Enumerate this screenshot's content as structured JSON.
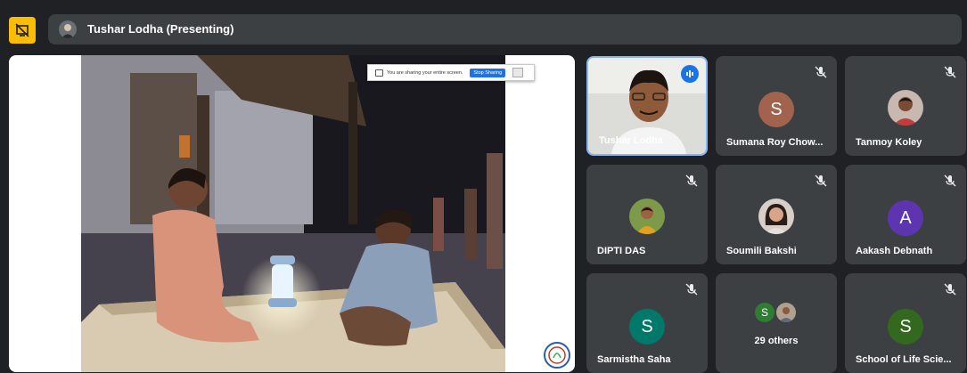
{
  "presenter": {
    "name": "Tushar Lodha (Presenting)"
  },
  "share_bar": {
    "message": "You are sharing your entire screen.",
    "stop_label": "Stop Sharing"
  },
  "participants": [
    {
      "name": "Tushar Lodha",
      "type": "video",
      "speaking": true
    },
    {
      "name": "Sumana Roy Chow...",
      "type": "letter",
      "letter": "S",
      "color": "#a1634d",
      "muted": true
    },
    {
      "name": "Tanmoy Koley",
      "type": "photo",
      "muted": true
    },
    {
      "name": "DIPTI DAS",
      "type": "photo",
      "muted": true
    },
    {
      "name": "Soumili Bakshi",
      "type": "photo",
      "muted": true
    },
    {
      "name": "Aakash Debnath",
      "type": "letter",
      "letter": "A",
      "color": "#5e35b1",
      "muted": true
    },
    {
      "name": "Sarmistha Saha",
      "type": "letter",
      "letter": "S",
      "color": "#00796b",
      "muted": true
    },
    {
      "name": "29 others",
      "type": "others",
      "letter": "S",
      "color": "#2e7d32"
    },
    {
      "name": "School of Life Scie...",
      "type": "letter",
      "letter": "S",
      "color": "#33691e",
      "muted": true
    }
  ],
  "colors": {
    "background": "#202124",
    "tile": "#3c4043",
    "present_button": "#fbbc04",
    "active_border": "#8ab4f8",
    "speaking": "#1a73e8"
  }
}
